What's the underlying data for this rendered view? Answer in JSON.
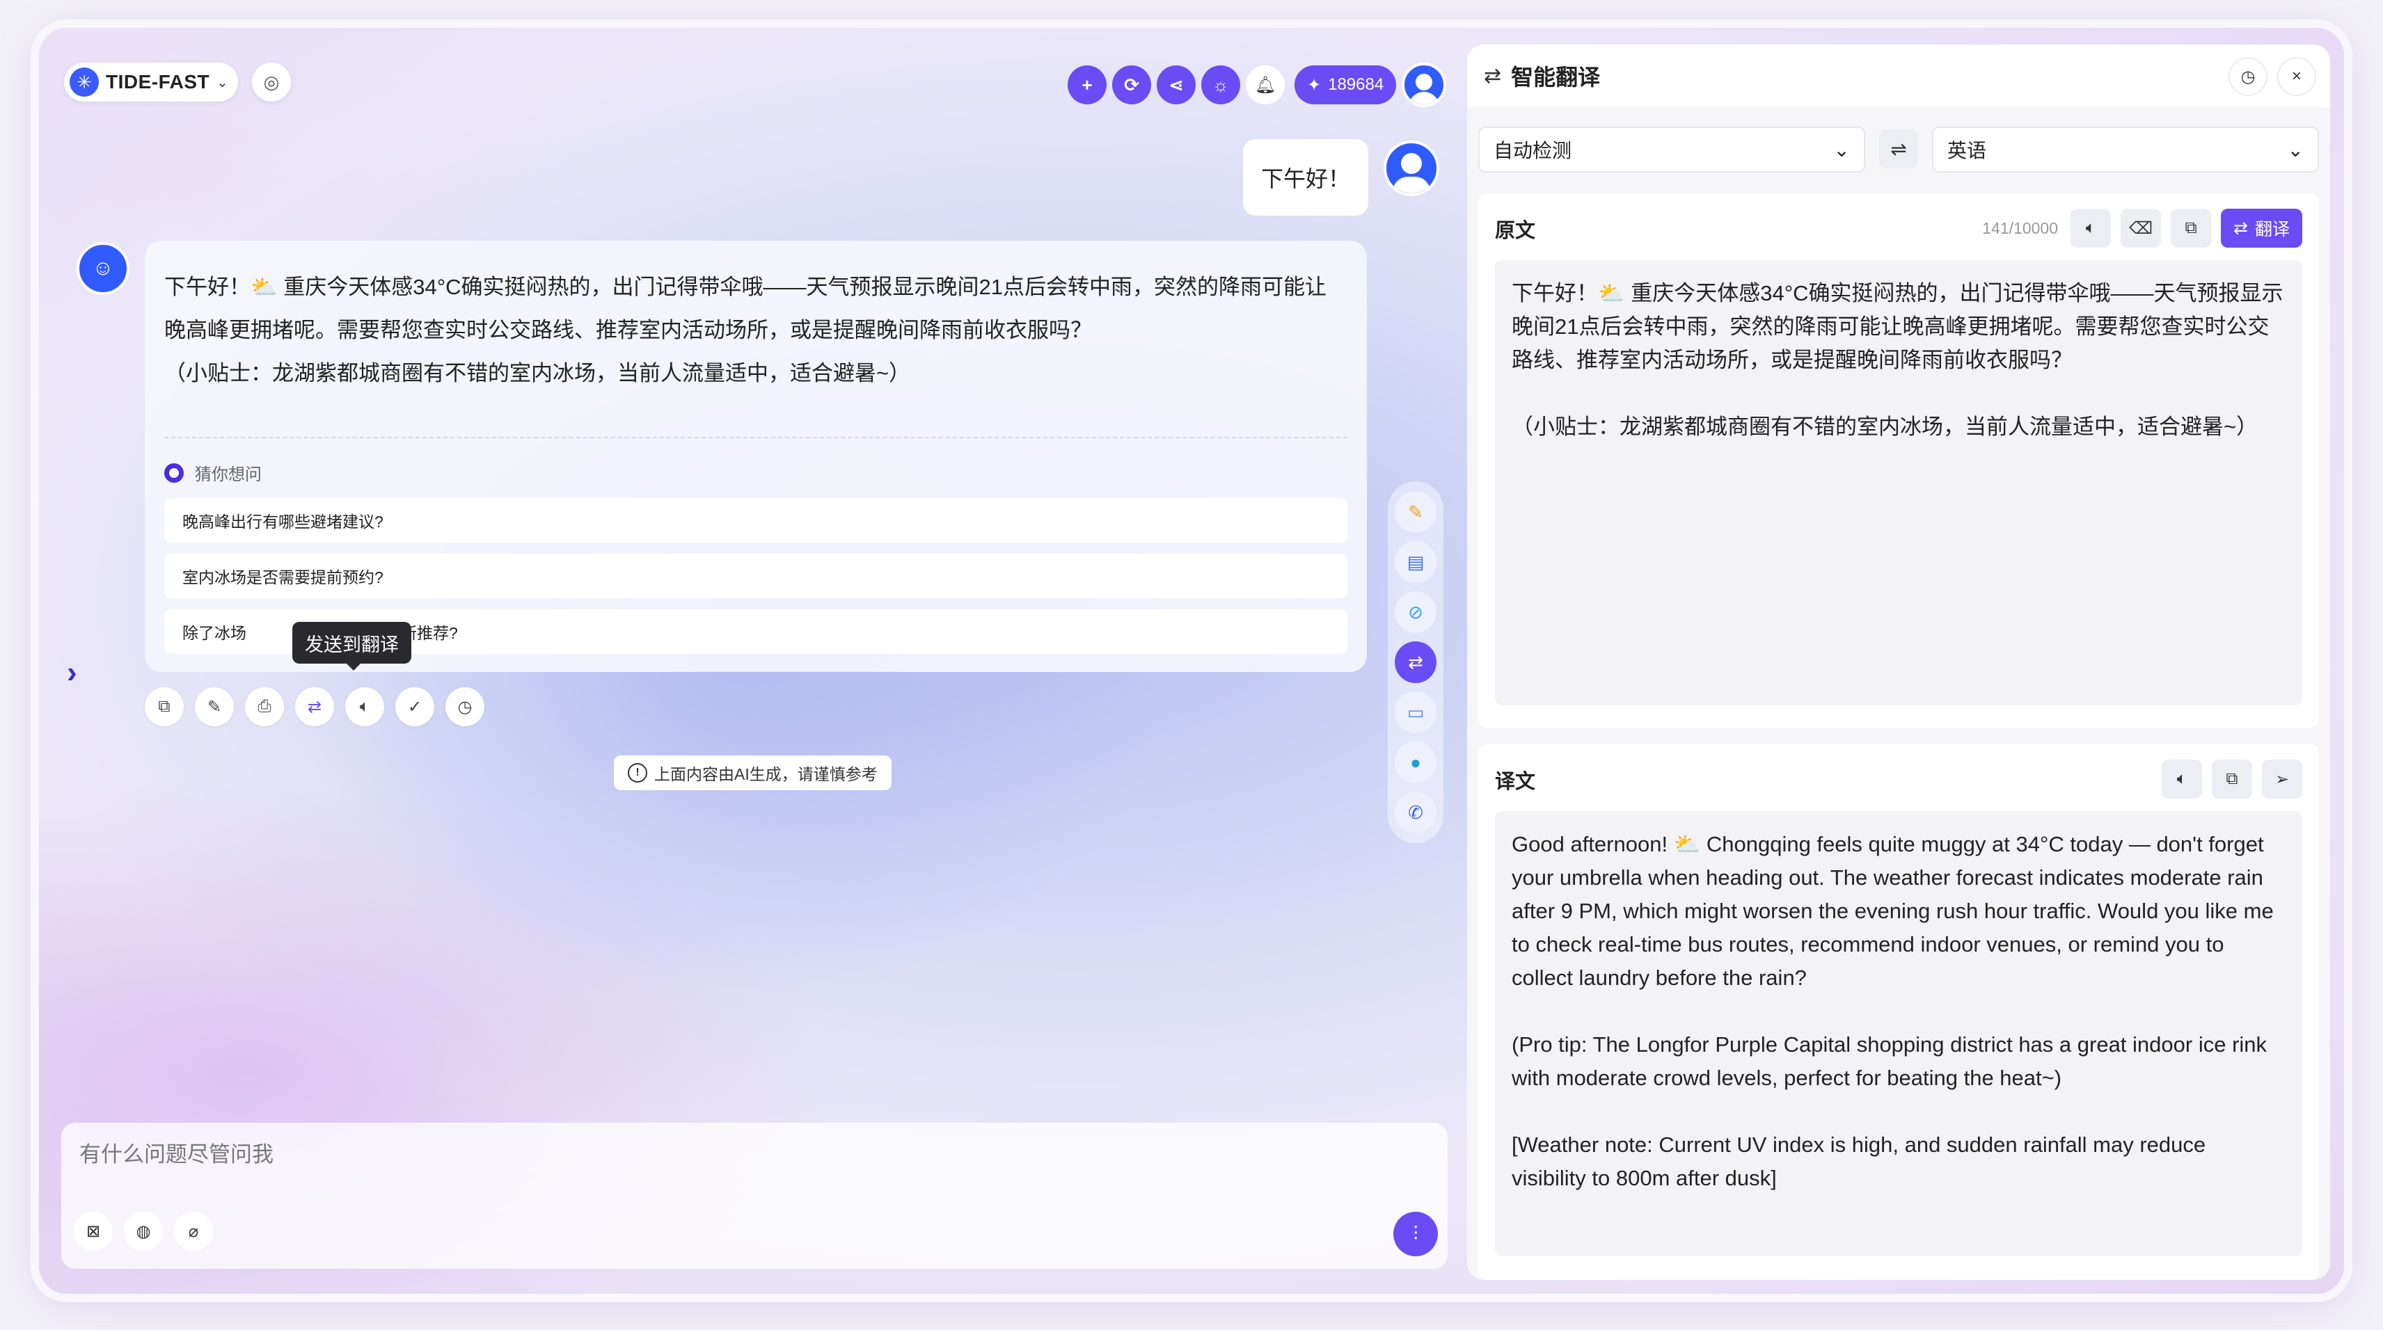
{
  "app": {
    "brand": "TIDE-FAST",
    "credits": "189684"
  },
  "chat": {
    "user_message": "下午好！",
    "bot_message": "下午好！⛅ 重庆今天体感34°C确实挺闷热的，出门记得带伞哦——天气预报显示晚间21点后会转中雨，突然的降雨可能让晚高峰更拥堵呢。需要帮您查实时公交路线、推荐室内活动场所，或是提醒晚间降雨前收衣服吗？",
    "bot_tip": "（小贴士：龙湖紫都城商圈有不错的室内冰场，当前人流量适中，适合避暑~）",
    "guess_title": "猜你想问",
    "suggestions": [
      "晚高峰出行有哪些避堵建议?",
      "室内冰场是否需要提前预约?",
      "除了冰场还有哪些避暑场所推荐?"
    ],
    "suggestion_3_visible_start": "除了冰场",
    "suggestion_3_visible_end": "暑场所推荐?",
    "tooltip": "发送到翻译",
    "ai_note": "上面内容由AI生成，请谨慎参考",
    "input_placeholder": "有什么问题尽管问我"
  },
  "translate": {
    "title": "智能翻译",
    "source_lang": "自动检测",
    "target_lang": "英语",
    "source_title": "原文",
    "char_count": "141/10000",
    "translate_label": "翻译",
    "source_paragraphs": [
      "下午好！⛅ 重庆今天体感34°C确实挺闷热的，出门记得带伞哦——天气预报显示晚间21点后会转中雨，突然的降雨可能让晚高峰更拥堵呢。需要帮您查实时公交路线、推荐室内活动场所，或是提醒晚间降雨前收衣服吗？",
      "（小贴士：龙湖紫都城商圈有不错的室内冰场，当前人流量适中，适合避暑~）"
    ],
    "target_title": "译文",
    "target_paragraphs": [
      "Good afternoon! ⛅ Chongqing feels quite muggy at 34°C today — don't forget your umbrella when heading out. The weather forecast indicates moderate rain after 9 PM, which might worsen the evening rush hour traffic. Would you like me to check real-time bus routes, recommend indoor venues, or remind you to collect laundry before the rain?",
      "(Pro tip: The Longfor Purple Capital shopping district has a great indoor ice rink with moderate crowd levels, perfect for beating the heat~)",
      "[Weather note: Current UV index is high, and sudden rainfall may reduce visibility to 800m after dusk]"
    ]
  },
  "icons": {
    "brand": "spark-logo-icon",
    "settings": "target-icon",
    "add": "plus-icon",
    "refresh": "refresh-icon",
    "share": "share-icon",
    "theme": "sun-icon",
    "notifications": "bell-icon",
    "credits": "sparkle-icon"
  },
  "colors": {
    "accent": "#6a4cf5",
    "brand_blue": "#2f5bff"
  }
}
